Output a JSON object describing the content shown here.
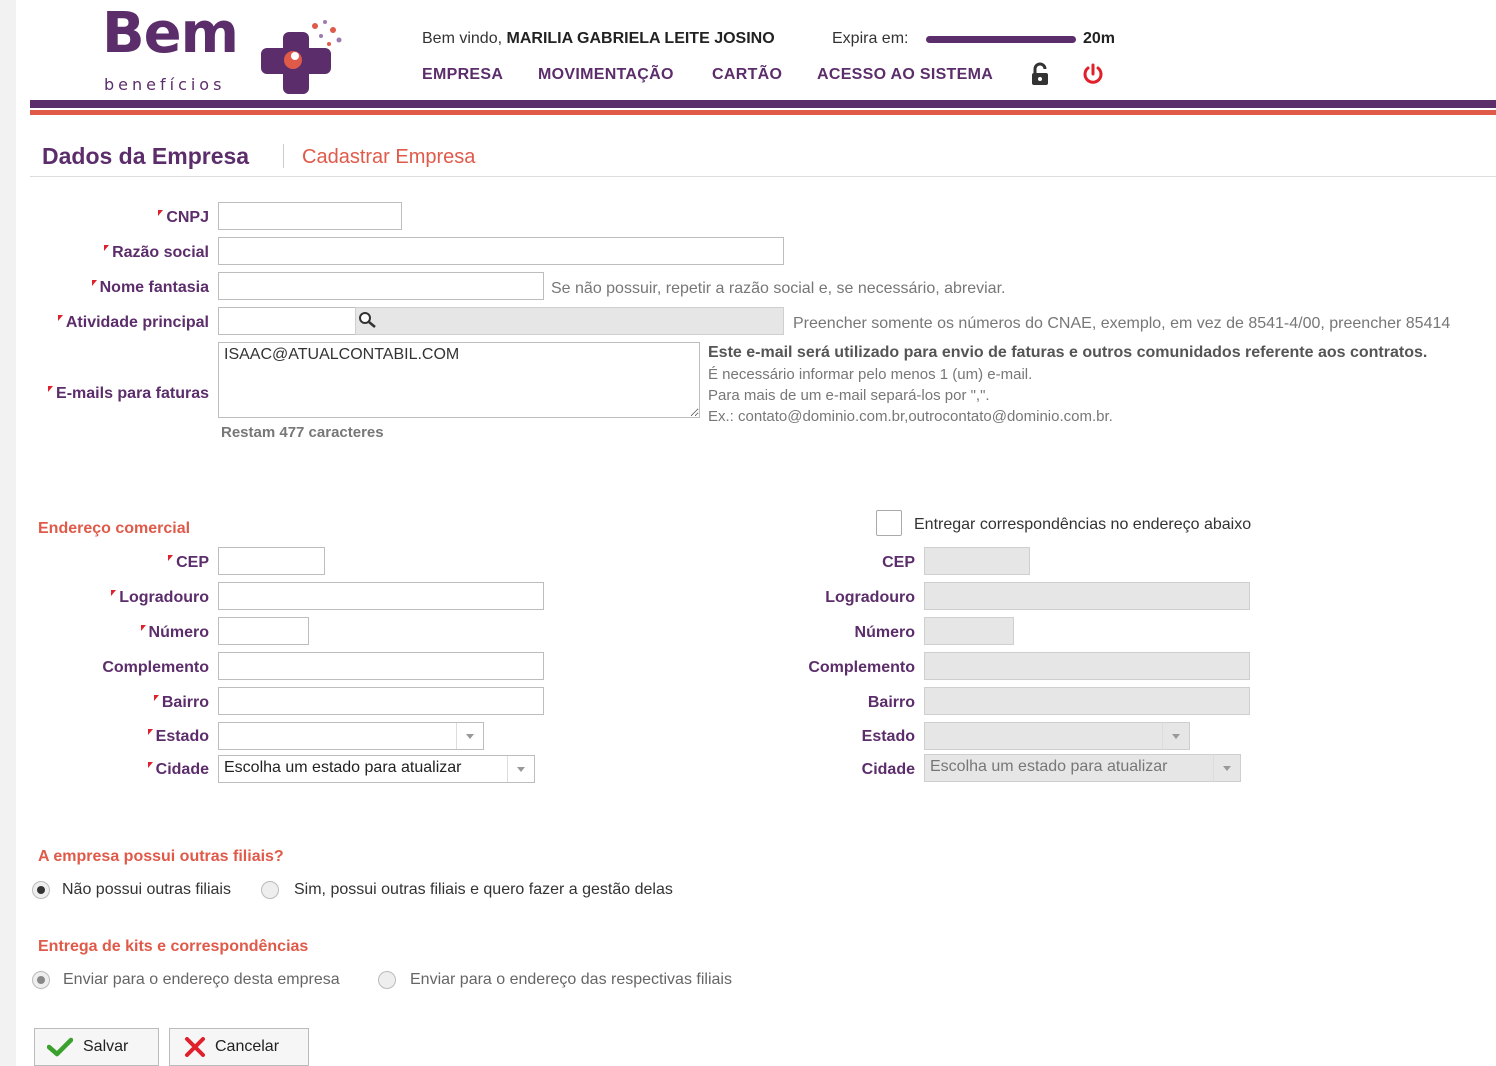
{
  "header": {
    "logo_main": "Bem",
    "logo_sub": "benefícios",
    "welcome_prefix": "Bem vindo,",
    "user_name": "MARILIA GABRIELA LEITE JOSINO",
    "expira_label": "Expira em:",
    "expira_value": "20m",
    "nav": [
      "EMPRESA",
      "MOVIMENTAÇÃO",
      "CARTÃO",
      "ACESSO AO SISTEMA"
    ],
    "brand_purple": "#5c2d6b",
    "brand_red": "#e05a4a"
  },
  "page": {
    "title": "Dados da Empresa",
    "subtitle": "Cadastrar Empresa"
  },
  "form": {
    "cnpj_label": "CNPJ",
    "cnpj_value": "",
    "razao_label": "Razão social",
    "razao_value": "",
    "fantasia_label": "Nome fantasia",
    "fantasia_value": "",
    "fantasia_hint": "Se não possuir, repetir a razão social e, se necessário, abreviar.",
    "atividade_label": "Atividade principal",
    "atividade_value": "",
    "atividade_hint": "Preencher somente os números do CNAE, exemplo, em vez de 8541-4/00, preencher 85414",
    "emails_label": "E-mails para faturas",
    "emails_value": "ISAAC@ATUALCONTABIL.COM",
    "emails_counter": "Restam 477 caracteres",
    "emails_hint_bold": "Este e-mail será utilizado para envio de faturas e outros comunidados referente aos contratos.",
    "emails_hint_1": "É necessário informar pelo menos 1 (um) e-mail.",
    "emails_hint_2": "Para mais de um e-mail separá-los por \",\".",
    "emails_hint_3": "Ex.: contato@dominio.com.br,outrocontato@dominio.com.br."
  },
  "address": {
    "section_title": "Endereço comercial",
    "deliver_checkbox_label": "Entregar correspondências no endereço abaixo",
    "deliver_checked": false,
    "cep_label": "CEP",
    "logradouro_label": "Logradouro",
    "numero_label": "Número",
    "complemento_label": "Complemento",
    "bairro_label": "Bairro",
    "estado_label": "Estado",
    "estado_value": "",
    "cidade_label": "Cidade",
    "cidade_value": "Escolha um estado para atualizar"
  },
  "filiais": {
    "question": "A empresa possui outras filiais?",
    "option_no": "Não possui outras filiais",
    "option_yes": "Sim, possui outras filiais e quero fazer a gestão delas",
    "selected": "no"
  },
  "kits": {
    "title": "Entrega de kits e correspondências",
    "option_empresa": "Enviar para o endereço desta empresa",
    "option_filiais": "Enviar para o endereço das respectivas filiais",
    "selected": "empresa"
  },
  "actions": {
    "save_label": "Salvar",
    "cancel_label": "Cancelar"
  }
}
